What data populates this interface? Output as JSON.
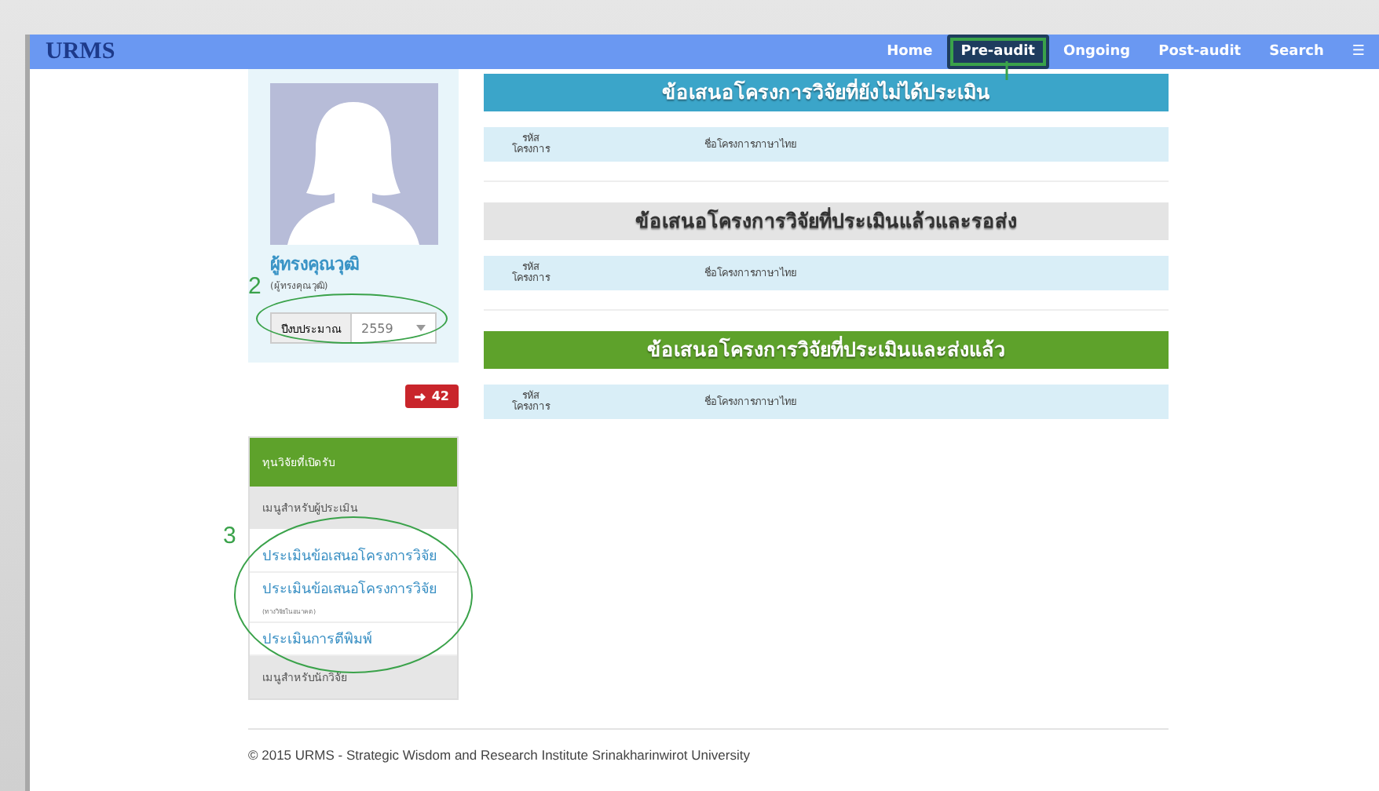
{
  "navbar": {
    "logo": "URMS",
    "items": [
      {
        "label": "Home",
        "selected": false
      },
      {
        "label": "Pre-audit",
        "selected": true
      },
      {
        "label": "Ongoing",
        "selected": false
      },
      {
        "label": "Post-audit",
        "selected": false
      },
      {
        "label": "Search",
        "selected": false
      },
      {
        "label": "☰",
        "selected": false
      }
    ]
  },
  "profile": {
    "name": "ผู้ทรงคุณวุฒิ",
    "role": "(ผู้ทรงคุณวุฒิ)",
    "year_label": "ปีงบประมาณ",
    "year": "2559"
  },
  "badge": {
    "count": "42"
  },
  "menu": [
    {
      "kind": "header",
      "label": "ทุนวิจัยที่เปิดรับ"
    },
    {
      "kind": "section",
      "label": "เมนูสำหรับผู้ประเมิน"
    },
    {
      "kind": "link",
      "label": "ประเมินข้อเสนอโครงการวิจัย"
    },
    {
      "kind": "link",
      "label": "ประเมินข้อเสนอโครงการวิจัย",
      "note": "(ทางวิจัยในอนาคต)"
    },
    {
      "kind": "link",
      "label": "ประเมินการตีพิมพ์"
    },
    {
      "kind": "section",
      "label": "เมนูสำหรับนักวิจัย"
    }
  ],
  "sections": [
    {
      "title": "ข้อเสนอโครงการวิจัยที่ยังไม่ได้ประเมิน",
      "color": "#3ba5c9",
      "columns": [
        "รหัส\nโครงการ",
        "ชื่อโครงการภาษาไทย"
      ]
    },
    {
      "title": "ข้อเสนอโครงการวิจัยที่ประเมินแล้วและรอส่ง",
      "color": "#e4e4e4",
      "columns": [
        "รหัส\nโครงการ",
        "ชื่อโครงการภาษาไทย"
      ]
    },
    {
      "title": "ข้อเสนอโครงการวิจัยที่ประเมินและส่งแล้ว",
      "color": "#5ea22b",
      "columns": [
        "รหัส\nโครงการ",
        "ชื่อโครงการภาษาไทย"
      ]
    }
  ],
  "annotations": [
    "2",
    "3"
  ],
  "footer": "© 2015 URMS - Strategic Wisdom and Research Institute Srinakharinwirot University"
}
